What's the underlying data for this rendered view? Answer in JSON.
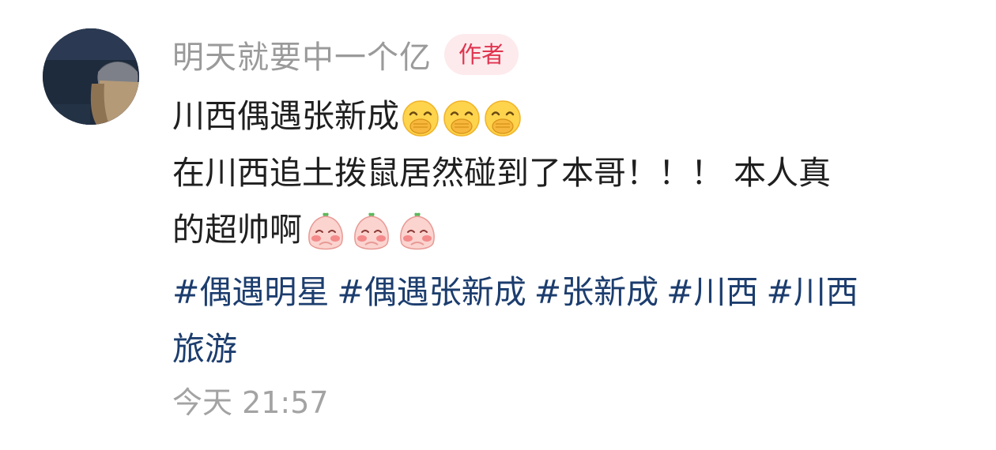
{
  "comment": {
    "author": {
      "username": "明天就要中一个亿",
      "badge": "作者"
    },
    "title": "川西偶遇张新成",
    "title_emojis": [
      "cover-mouth-smile-icon",
      "cover-mouth-smile-icon",
      "cover-mouth-smile-icon"
    ],
    "body_line1": "在川西追土拨鼠居然碰到了本哥！！！ 本人真",
    "body_line2": "的超帅啊",
    "body_emojis": [
      "blushing-peach-icon",
      "blushing-peach-icon",
      "blushing-peach-icon"
    ],
    "hashtags": {
      "row1": [
        "#偶遇明星",
        "#偶遇张新成",
        "#张新成",
        "#川西",
        "#川西"
      ],
      "row2": [
        "旅游"
      ]
    },
    "timestamp": "今天 21:57"
  },
  "colors": {
    "username": "#9a9a9a",
    "badge_bg": "#fdeaec",
    "badge_text": "#e0344f",
    "body_text": "#1f1f1f",
    "hashtag": "#1c3d6e",
    "timestamp": "#a3a3a3"
  }
}
